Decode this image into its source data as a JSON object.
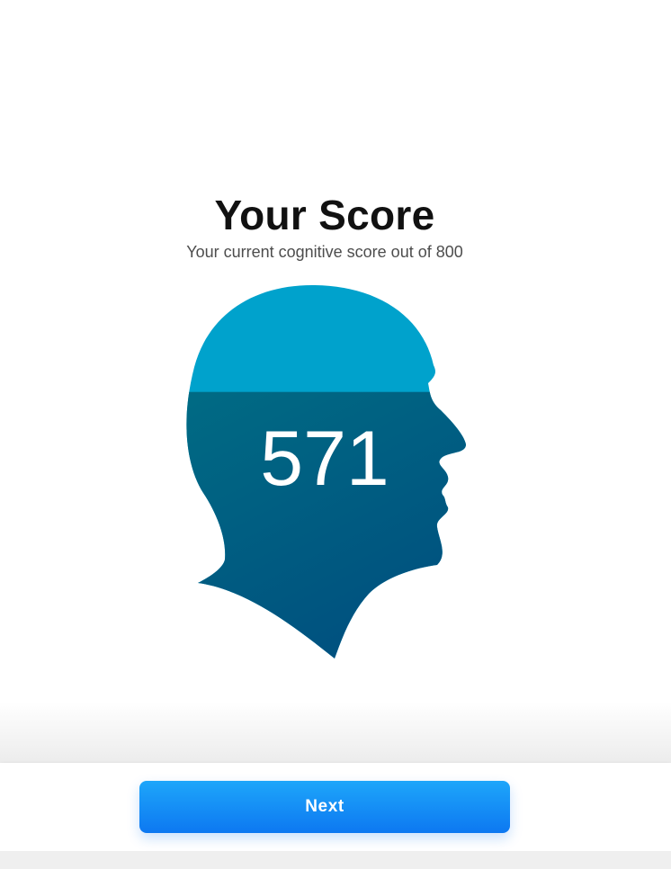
{
  "header": {
    "title": "Your Score",
    "subtitle": "Your current cognitive score out of 800"
  },
  "score": {
    "value": "571",
    "max": 800,
    "fill_fraction": 0.714,
    "icon": "head-profile-icon",
    "colors": {
      "filled": "#00608a",
      "filled_light": "#006b84",
      "unfilled": "#00a2cc",
      "number": "#ffffff"
    }
  },
  "footer": {
    "next_label": "Next",
    "button_color": "#1492f5"
  }
}
